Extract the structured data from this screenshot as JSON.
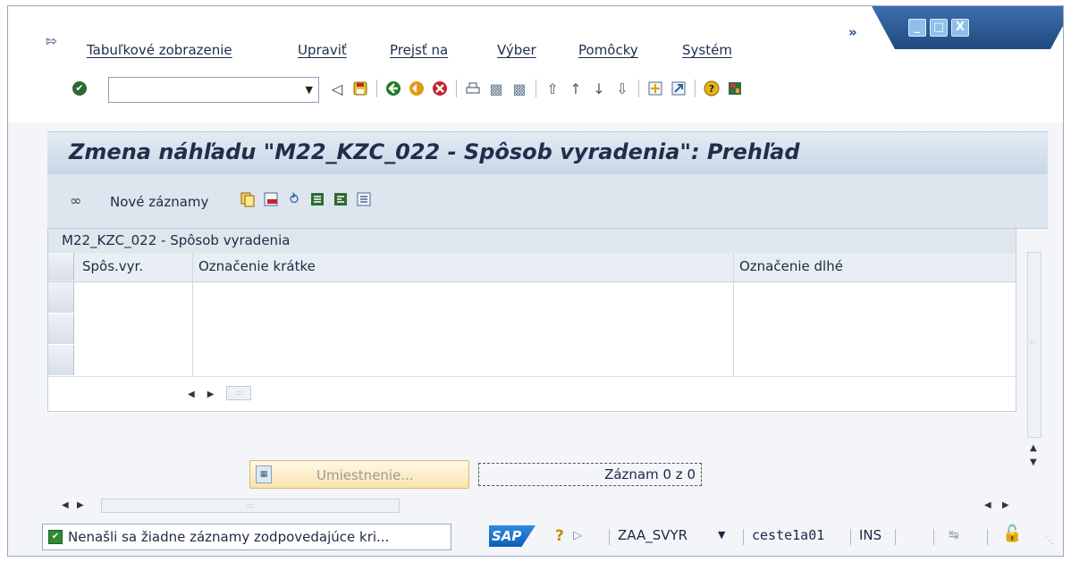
{
  "menu": {
    "items": [
      "Tabuľkové zobrazenie",
      "Upraviť",
      "Prejsť na",
      "Výber",
      "Pomôcky",
      "Systém"
    ],
    "more": "»"
  },
  "window_controls": {
    "minimize": "_",
    "maximize": "□",
    "close": "X"
  },
  "toolbar": {
    "command_value": "",
    "icons": [
      "back-arrow-icon",
      "save-icon",
      "back-green-icon",
      "exit-icon",
      "cancel-icon",
      "print-icon",
      "find-icon",
      "find-next-icon",
      "first-page-icon",
      "previous-page-icon",
      "next-page-icon",
      "last-page-icon",
      "create-session-icon",
      "shortcut-icon",
      "help-icon",
      "customize-layout-icon"
    ]
  },
  "page": {
    "title": "Zmena náhľadu \"M22_KZC_022 - Spôsob vyradenia\": Prehľad"
  },
  "app_toolbar": {
    "new_entries": "Nové záznamy",
    "icons": [
      "copy-icon",
      "delete-icon",
      "undo-icon",
      "select-all-icon",
      "select-block-icon",
      "deselect-all-icon"
    ]
  },
  "table": {
    "title": "M22_KZC_022 - Spôsob vyradenia",
    "columns": [
      "Spôs.vyr.",
      "Označenie krátke",
      "Označenie dlhé"
    ],
    "rows": [
      [
        "",
        "",
        ""
      ],
      [
        "",
        "",
        ""
      ],
      [
        "",
        "",
        ""
      ]
    ]
  },
  "footer_controls": {
    "position_button": "Umiestnenie...",
    "entry_count": "Záznam 0 z 0"
  },
  "status": {
    "message": "Nenašli sa žiadne záznamy zodpovedajúce kri...",
    "sap_logo": "SAP",
    "transaction": "ZAA_SVYR",
    "server": "ceste1a01",
    "mode": "INS"
  },
  "colors": {
    "title_band": "#c8d6e6",
    "app_toolbar": "#dde5ee",
    "status_ok": "#2e8b32",
    "window_button": "#8fbfe9"
  }
}
